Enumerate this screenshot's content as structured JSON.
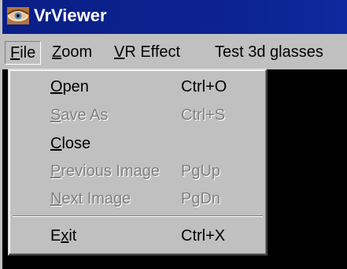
{
  "window": {
    "title": "VrViewer"
  },
  "menubar": {
    "items": [
      {
        "mnemonic": "F",
        "rest": "ile"
      },
      {
        "mnemonic": "Z",
        "rest": "oom"
      },
      {
        "mnemonic": "V",
        "rest": "R Effect"
      },
      {
        "label": "Test 3d glasses"
      }
    ]
  },
  "file_menu": {
    "items": [
      {
        "mnemonic": "O",
        "rest": "pen",
        "accel": "Ctrl+O",
        "enabled": true
      },
      {
        "mnemonic": "S",
        "rest": "ave As",
        "accel": "Ctrl+S",
        "enabled": false
      },
      {
        "mnemonic": "C",
        "rest": "lose",
        "accel": "",
        "enabled": true
      },
      {
        "mnemonic": "P",
        "rest": "revious Image",
        "accel": "PgUp",
        "enabled": false
      },
      {
        "mnemonic": "N",
        "rest": "ext Image",
        "accel": "PgDn",
        "enabled": false
      },
      {
        "pre": "E",
        "mnemonic": "x",
        "rest": "it",
        "accel": "Ctrl+X",
        "enabled": true
      }
    ]
  },
  "colors": {
    "titlebar": "#0a1f86",
    "menu_bg": "#c0c0c0",
    "disabled_text": "#808080",
    "viewport_bg": "#000000"
  }
}
